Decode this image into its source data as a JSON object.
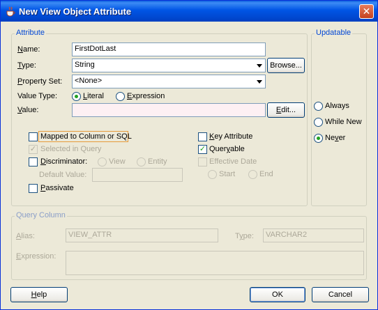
{
  "window": {
    "title": "New View Object Attribute",
    "close_label": "✕"
  },
  "attribute": {
    "legend": "Attribute",
    "name_label": "Name:",
    "name_value": "FirstDotLast",
    "type_label": "Type:",
    "type_value": "String",
    "browse_label": "Browse...",
    "property_set_label": "Property Set:",
    "property_set_value": "<None>",
    "value_type_label": "Value Type:",
    "literal_label": "Literal",
    "expression_label": "Expression",
    "value_label": "Value:",
    "value_value": "",
    "edit_label": "Edit...",
    "mapped_label": "Mapped to Column or SQL",
    "selected_in_query_label": "Selected in Query",
    "discriminator_label": "Discriminator:",
    "view_label": "View",
    "entity_label": "Entity",
    "default_value_label": "Default Value:",
    "passivate_label": "Passivate",
    "key_attribute_label": "Key Attribute",
    "queryable_label": "Queryable",
    "effective_date_label": "Effective Date",
    "start_label": "Start",
    "end_label": "End"
  },
  "updatable": {
    "legend": "Updatable",
    "always_label": "Always",
    "while_new_label": "While New",
    "never_label": "Never"
  },
  "query_column": {
    "legend": "Query Column",
    "alias_label": "Alias:",
    "alias_value": "VIEW_ATTR",
    "type_label": "Type:",
    "type_value": "VARCHAR2",
    "expression_label": "Expression:"
  },
  "footer": {
    "help_label": "Help",
    "ok_label": "OK",
    "cancel_label": "Cancel"
  }
}
